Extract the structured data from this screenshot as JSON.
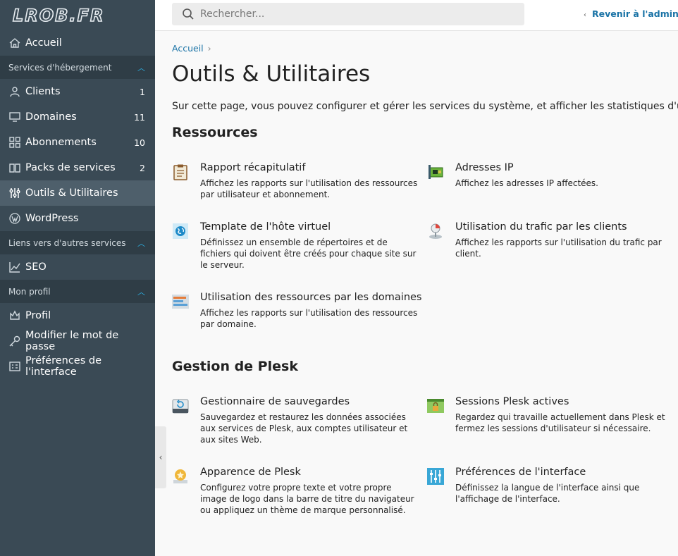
{
  "logo": {
    "text": "LROB.FR"
  },
  "sidebar": {
    "top_items": [
      {
        "label": "Accueil",
        "icon": "home-icon"
      }
    ],
    "sections": [
      {
        "title": "Services d'hébergement",
        "items": [
          {
            "label": "Clients",
            "count": "1",
            "icon": "user-icon"
          },
          {
            "label": "Domaines",
            "count": "11",
            "icon": "monitor-icon"
          },
          {
            "label": "Abonnements",
            "count": "10",
            "icon": "grid-icon"
          },
          {
            "label": "Packs de services",
            "count": "2",
            "icon": "book-icon"
          },
          {
            "label": "Outils & Utilitaires",
            "count": "",
            "icon": "sliders-icon",
            "active": true
          },
          {
            "label": "WordPress",
            "count": "",
            "icon": "wordpress-icon"
          }
        ]
      },
      {
        "title": "Liens vers d'autres services",
        "items": [
          {
            "label": "SEO",
            "count": "",
            "icon": "chart-icon"
          }
        ]
      },
      {
        "title": "Mon profil",
        "items": [
          {
            "label": "Profil",
            "count": "",
            "icon": "profile-icon"
          },
          {
            "label": "Modifier le mot de passe",
            "count": "",
            "icon": "key-icon"
          },
          {
            "label": "Préférences de l'interface",
            "count": "",
            "icon": "preferences-icon"
          }
        ]
      }
    ]
  },
  "topbar": {
    "search_placeholder": "Rechercher...",
    "back_link": "Revenir à l'administr"
  },
  "main": {
    "breadcrumb": "Accueil",
    "title": "Outils & Utilitaires",
    "description": "Sur cette page, vous pouvez configurer et gérer les services du système, et afficher les statistiques d'utilisation",
    "sections": [
      {
        "title": "Ressources",
        "tools": [
          {
            "title": "Rapport récapitulatif",
            "desc": "Affichez les rapports sur l'utilisation des ressources par utilisateur et abonnement.",
            "icon": "clipboard-icon"
          },
          {
            "title": "Adresses IP",
            "desc": "Affichez les adresses IP affectées.",
            "icon": "network-card-icon"
          },
          {
            "title": "Template de l'hôte virtuel",
            "desc": "Définissez un ensemble de répertoires et de fichiers qui doivent être créés pour chaque site sur le serveur.",
            "icon": "globe-icon"
          },
          {
            "title": "Utilisation du trafic par les clients",
            "desc": "Affichez les rapports sur l'utilisation du trafic par client.",
            "icon": "traffic-pie-icon"
          },
          {
            "title": "Utilisation des ressources par les domaines",
            "desc": "Affichez les rapports sur l'utilisation des ressources par domaine.",
            "icon": "bars-report-icon"
          }
        ]
      },
      {
        "title": "Gestion de Plesk",
        "tools": [
          {
            "title": "Gestionnaire de sauvegardes",
            "desc": "Sauvegardez et restaurez les données associées aux services de Plesk, aux comptes utilisateur et aux sites Web.",
            "icon": "backup-drive-icon"
          },
          {
            "title": "Sessions Plesk actives",
            "desc": "Regardez qui travaille actuellement dans Plesk et fermez les sessions d'utilisateur si nécessaire.",
            "icon": "sessions-lock-icon"
          },
          {
            "title": "Apparence de Plesk",
            "desc": "Configurez votre propre texte et votre propre image de logo dans la barre de titre du navigateur ou appliquez un thème de marque personnalisé.",
            "icon": "appearance-star-icon"
          },
          {
            "title": "Préférences de l'interface",
            "desc": "Définissez la langue de l'interface ainsi que l'affichage de l'interface.",
            "icon": "interface-sliders-icon"
          }
        ]
      }
    ]
  },
  "colors": {
    "sidebar_bg": "#3a4a55",
    "sidebar_section_bg": "#2f3d46",
    "sidebar_active_bg": "#4e5f6b",
    "link": "#1a73a6",
    "chevron_accent": "#2cb3e8"
  }
}
